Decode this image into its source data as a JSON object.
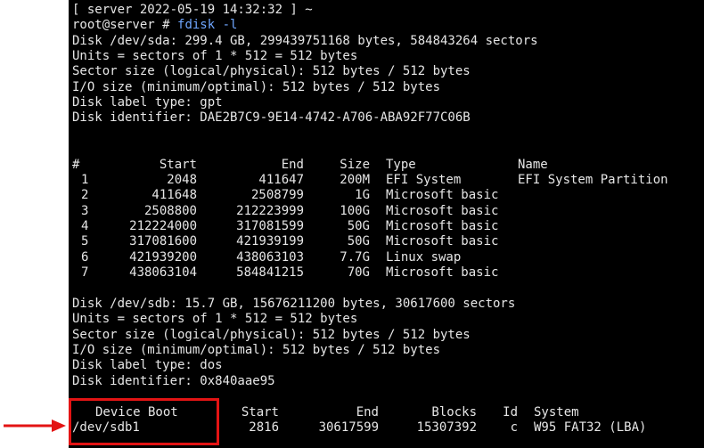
{
  "terminal": {
    "prompt_line": "[ server 2022-05-19 14:32:32 ] ~",
    "command_prefix": "root@server # ",
    "command": "fdisk -l",
    "sda": {
      "summary": "Disk /dev/sda: 299.4 GB, 299439751168 bytes, 584843264 sectors",
      "units": "Units = sectors of 1 * 512 = 512 bytes",
      "sector_size": "Sector size (logical/physical): 512 bytes / 512 bytes",
      "io_size": "I/O size (minimum/optimal): 512 bytes / 512 bytes",
      "label_type": "Disk label type: gpt",
      "identifier": "Disk identifier: DAE2B7C9-9E14-4742-A706-ABA92F77C06B",
      "table": {
        "headers": [
          "#",
          "Start",
          "End",
          "Size",
          "Type",
          "Name"
        ],
        "rows": [
          [
            "1",
            "2048",
            "411647",
            "200M",
            "EFI System",
            "EFI System Partition"
          ],
          [
            "2",
            "411648",
            "2508799",
            "1G",
            "Microsoft basic",
            ""
          ],
          [
            "3",
            "2508800",
            "212223999",
            "100G",
            "Microsoft basic",
            ""
          ],
          [
            "4",
            "212224000",
            "317081599",
            "50G",
            "Microsoft basic",
            ""
          ],
          [
            "5",
            "317081600",
            "421939199",
            "50G",
            "Microsoft basic",
            ""
          ],
          [
            "6",
            "421939200",
            "438063103",
            "7.7G",
            "Linux swap",
            ""
          ],
          [
            "7",
            "438063104",
            "584841215",
            "70G",
            "Microsoft basic",
            ""
          ]
        ]
      }
    },
    "sdb": {
      "summary": "Disk /dev/sdb: 15.7 GB, 15676211200 bytes, 30617600 sectors",
      "units": "Units = sectors of 1 * 512 = 512 bytes",
      "sector_size": "Sector size (logical/physical): 512 bytes / 512 bytes",
      "io_size": "I/O size (minimum/optimal): 512 bytes / 512 bytes",
      "label_type": "Disk label type: dos",
      "identifier": "Disk identifier: 0x840aae95",
      "table": {
        "headers": [
          "Device Boot",
          "Start",
          "End",
          "Blocks",
          "Id",
          "System"
        ],
        "rows": [
          [
            "/dev/sdb1",
            "2816",
            "30617599",
            "15307392",
            "c",
            "W95 FAT32 (LBA)"
          ]
        ]
      }
    }
  },
  "colors": {
    "terminal_bg": "#000000",
    "terminal_fg": "#e6e6e6",
    "command_color": "#6fa6ff",
    "annotation_red": "#e31414"
  }
}
